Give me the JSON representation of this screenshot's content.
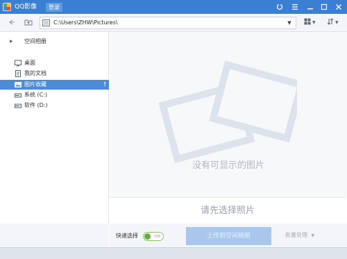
{
  "app": {
    "title": "QQ影像",
    "login_label": "登录"
  },
  "address": {
    "path": "C:\\Users\\ZHW\\Pictures\\"
  },
  "sidebar": {
    "items": [
      {
        "label": "空间相册",
        "icon": "arrow-right-icon"
      },
      {
        "label": "桌面",
        "icon": "desktop-icon"
      },
      {
        "label": "我的文档",
        "icon": "document-icon"
      },
      {
        "label": "图片收藏",
        "icon": "picture-folder-icon",
        "selected": true
      },
      {
        "label": "系统 (C:)",
        "icon": "drive-icon"
      },
      {
        "label": "软件 (D:)",
        "icon": "drive-icon"
      }
    ]
  },
  "main": {
    "empty_text": "没有可显示的图片"
  },
  "selection": {
    "prompt": "请先选择照片"
  },
  "bottom": {
    "quick_select_label": "快速选择",
    "toggle_state": "ON",
    "upload_label": "上传到空间相册",
    "batch_label": "批量处理"
  },
  "colors": {
    "titlebar": "#3b7fd4",
    "selected": "#4d8bd6",
    "upload_button": "#a9c6ec"
  }
}
